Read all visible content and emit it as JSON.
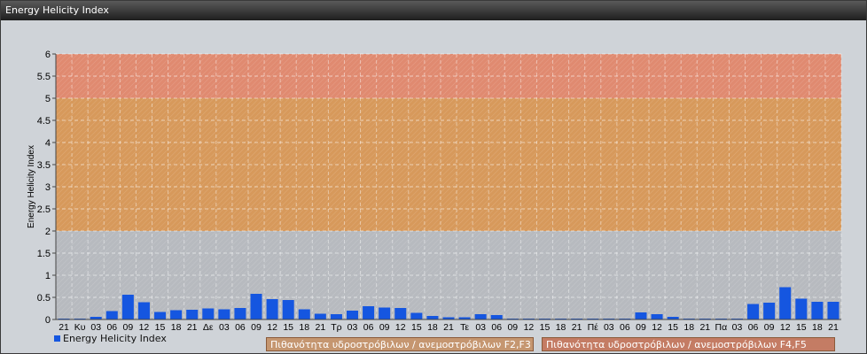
{
  "window": {
    "title": "Energy Helicity Index"
  },
  "colors": {
    "bar": "#1556e0",
    "band_low": "#b7babf",
    "band_mid": "#d7995b",
    "band_high": "#e08a70",
    "band_mid_label": "#c59670",
    "band_high_label": "#c47c64"
  },
  "bands": {
    "f2f3": "Πιθανότητα υδροστρόβιλων / ανεμοστρόβιλων F2,F3",
    "f4f5": "Πιθανότητα υδροστρόβιλων / ανεμοστρόβιλων F4,F5"
  },
  "chart_data": {
    "type": "bar",
    "ylabel": "Energy Helicity Index",
    "ylim": [
      0,
      6
    ],
    "yticks": [
      "0",
      "0.5",
      "1",
      "1.5",
      "2",
      "2.5",
      "3",
      "3.5",
      "4",
      "4.5",
      "5",
      "5.5",
      "6"
    ],
    "grid": true,
    "legend": "bottom-left",
    "bands": [
      {
        "from": 0,
        "to": 2,
        "color": "#b7babf"
      },
      {
        "from": 2,
        "to": 5,
        "color": "#d7995b"
      },
      {
        "from": 5,
        "to": 6,
        "color": "#e08a70"
      }
    ],
    "categories": [
      "21",
      "Κυ",
      "03",
      "06",
      "09",
      "12",
      "15",
      "18",
      "21",
      "Δε",
      "03",
      "06",
      "09",
      "12",
      "15",
      "18",
      "21",
      "Τρ",
      "03",
      "06",
      "09",
      "12",
      "15",
      "18",
      "21",
      "Τε",
      "03",
      "06",
      "09",
      "12",
      "15",
      "18",
      "21",
      "Πέ",
      "03",
      "06",
      "09",
      "12",
      "15",
      "18",
      "21",
      "Πα",
      "03",
      "06",
      "09",
      "12",
      "15",
      "18",
      "21"
    ],
    "series": [
      {
        "name": "Energy Helicity Index",
        "values": [
          0.02,
          0.02,
          0.06,
          0.19,
          0.56,
          0.39,
          0.17,
          0.21,
          0.22,
          0.25,
          0.23,
          0.26,
          0.58,
          0.46,
          0.44,
          0.23,
          0.13,
          0.12,
          0.2,
          0.3,
          0.27,
          0.26,
          0.15,
          0.08,
          0.05,
          0.05,
          0.12,
          0.1,
          0.02,
          0.02,
          0.02,
          0.02,
          0.02,
          0.02,
          0.02,
          0.02,
          0.16,
          0.12,
          0.06,
          0.02,
          0.02,
          0.02,
          0.02,
          0.35,
          0.38,
          0.73,
          0.47,
          0.4,
          0.4
        ]
      }
    ]
  }
}
